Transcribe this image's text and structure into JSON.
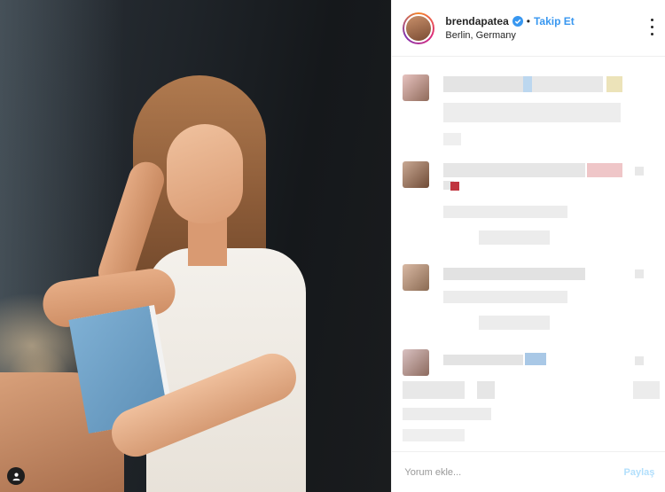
{
  "post": {
    "username": "brendapatea",
    "follow_label": "Takip Et",
    "location": "Berlin, Germany"
  },
  "comment_box": {
    "placeholder": "Yorum ekle...",
    "share_label": "Paylaş"
  },
  "icons": {
    "verified": "verified-badge-icon",
    "more": "more-options-icon",
    "user_tag": "user-tag-icon"
  },
  "colors": {
    "accent": "#3897f0",
    "share_disabled": "#b2dffc",
    "border": "#efefef",
    "text": "#262626"
  }
}
